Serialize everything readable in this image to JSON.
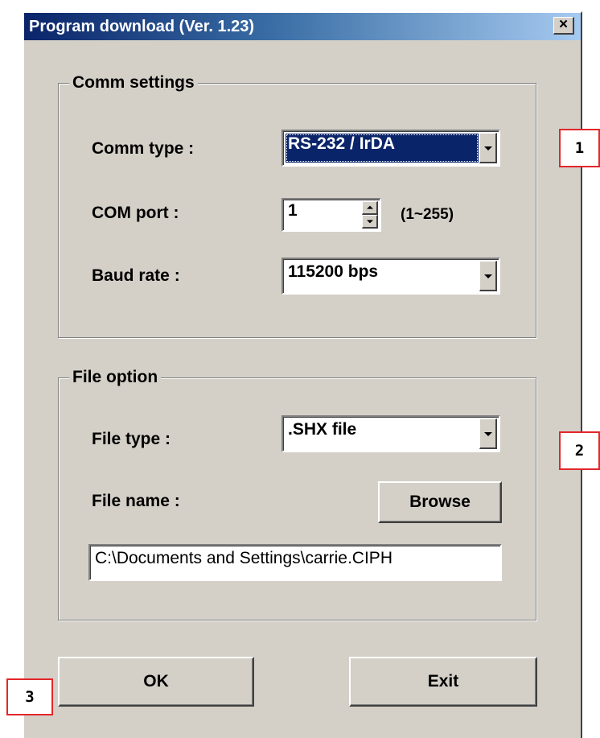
{
  "window": {
    "title": "Program download  (Ver. 1.23)",
    "close_glyph": "×"
  },
  "comm_settings": {
    "group_title": "Comm settings",
    "comm_type_label": "Comm type :",
    "comm_type_value": "RS-232 / IrDA",
    "com_port_label": "COM port :",
    "com_port_value": "1",
    "com_port_range": "(1~255)",
    "baud_rate_label": "Baud rate :",
    "baud_rate_value": "115200 bps"
  },
  "file_option": {
    "group_title": "File option",
    "file_type_label": "File type :",
    "file_type_value": ".SHX file",
    "file_name_label": "File name :",
    "browse_label": "Browse",
    "file_path_value": "C:\\Documents and Settings\\carrie.CIPH"
  },
  "buttons": {
    "ok_label": "OK",
    "exit_label": "Exit"
  },
  "callouts": {
    "one": "1",
    "two": "2",
    "three": "3"
  },
  "colors": {
    "dialog_face": "#d4d0c8",
    "title_active": "#0a246a",
    "selection": "#0a246a",
    "callout_border": "#e3262a"
  },
  "icons": {
    "combo_arrow": "chevron-down-icon",
    "spin_up": "spin-up-icon",
    "spin_down": "spin-down-icon",
    "close": "close-icon"
  }
}
